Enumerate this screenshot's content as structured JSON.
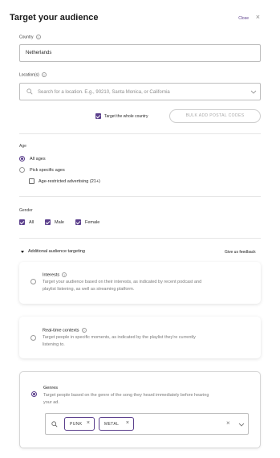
{
  "header": {
    "title": "Target your audience",
    "close_label": "Close"
  },
  "country": {
    "label": "Country",
    "value": "Netherlands"
  },
  "location": {
    "label": "Location(s)",
    "placeholder": "Search for a location. E.g., 90210, Santa Monica, or California",
    "whole_country_label": "Target the whole country",
    "whole_country_checked": true,
    "bulk_button_label": "BULK ADD POSTAL CODES"
  },
  "age": {
    "label": "Age",
    "options": [
      {
        "label": "All ages",
        "selected": true
      },
      {
        "label": "Pick specific ages",
        "selected": false
      }
    ],
    "restricted_label": "Age-restricted advertising (21+)",
    "restricted_checked": false
  },
  "gender": {
    "label": "Gender",
    "options": [
      {
        "label": "All",
        "checked": true
      },
      {
        "label": "Male",
        "checked": true
      },
      {
        "label": "Female",
        "checked": true
      }
    ]
  },
  "additional": {
    "title": "Additional audience targeting",
    "feedback_label": "Give us feedback",
    "cards": [
      {
        "title": "Interests",
        "description_lines": [
          "Target your audience based on their interests, as indicated by recent podcast and",
          "playlist listening, as well as streaming platform."
        ],
        "selected": false
      },
      {
        "title": "Real-time contexts",
        "description_lines": [
          "Target people in specific moments, as indicated by the playlist they're currently",
          "listening to."
        ],
        "selected": false
      },
      {
        "title": "Genres",
        "description_lines": [
          "Target people based on the genre of the song they heard immediately before hearing",
          "your ad."
        ],
        "selected": true
      }
    ],
    "genres_tags": [
      "PUNK",
      "METAL"
    ]
  },
  "colors": {
    "accent": "#5b3f8c",
    "border": "#bdbdbd",
    "muted_text": "#7a7a7a"
  },
  "icons": [
    "help-icon",
    "close-icon",
    "search-icon",
    "chevron-down-icon",
    "caret-down-icon"
  ]
}
